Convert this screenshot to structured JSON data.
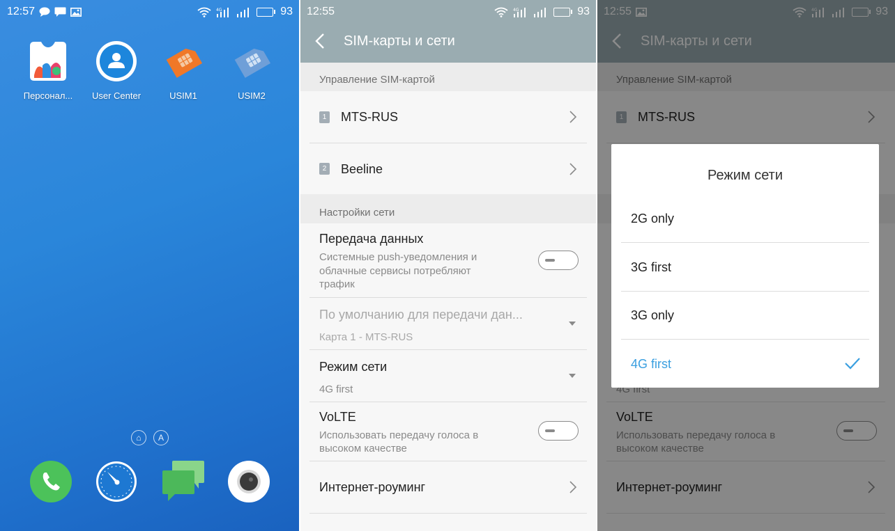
{
  "colors": {
    "accent": "#3a9fe0",
    "appbar_screen2": "#9aacb1",
    "appbar_screen3": "#575f62",
    "sim1_orange": "#f07828",
    "sim2_blue": "#6f9fd8"
  },
  "home": {
    "status": {
      "time": "12:57",
      "battery": "93",
      "battery_level": 0.93,
      "icons": [
        "chat-bubble-icon",
        "message-icon",
        "image-icon",
        "wifi-icon",
        "signal-4g-icon",
        "signal-icon",
        "battery-icon"
      ]
    },
    "apps": [
      {
        "label": "Персонал...",
        "icon": "themes-icon"
      },
      {
        "label": "User Center",
        "icon": "user-center-icon"
      },
      {
        "label": "USIM1",
        "icon": "sim-card-orange-icon"
      },
      {
        "label": "USIM2",
        "icon": "sim-card-blue-icon"
      }
    ],
    "page_indicator": {
      "home_glyph": "⌂",
      "letter": "A"
    },
    "dock": [
      "phone-icon",
      "browser-compass-icon",
      "messages-icon",
      "camera-icon"
    ]
  },
  "settings": {
    "status": {
      "time": "12:55",
      "battery": "93",
      "battery_level": 0.93
    },
    "title": "SIM-карты и сети",
    "sim_section": "Управление SIM-картой",
    "sims": [
      {
        "badge": "1",
        "name": "MTS-RUS"
      },
      {
        "badge": "2",
        "name": "Beeline"
      }
    ],
    "network_section": "Настройки сети",
    "data": {
      "title": "Передача данных",
      "subtitle_lines": [
        "Системные push-уведомления и",
        "облачные сервисы потребляют",
        "трафик"
      ],
      "enabled": false
    },
    "default_data": {
      "title": "По умолчанию для передачи дан...",
      "value": "Карта 1 - MTS-RUS"
    },
    "network_mode": {
      "title": "Режим сети",
      "value": "4G first"
    },
    "volte": {
      "title": "VoLTE",
      "subtitle_lines": [
        "Использовать передачу голоса в",
        "высоком качестве"
      ],
      "enabled": false
    },
    "roaming": {
      "title": "Интернет-роуминг"
    }
  },
  "dialog": {
    "status": {
      "time": "12:55",
      "battery": "93"
    },
    "title": "Режим сети",
    "options": [
      {
        "label": "2G only",
        "selected": false
      },
      {
        "label": "3G first",
        "selected": false
      },
      {
        "label": "3G only",
        "selected": false
      },
      {
        "label": "4G first",
        "selected": true
      }
    ],
    "behind_value": "4G first"
  }
}
